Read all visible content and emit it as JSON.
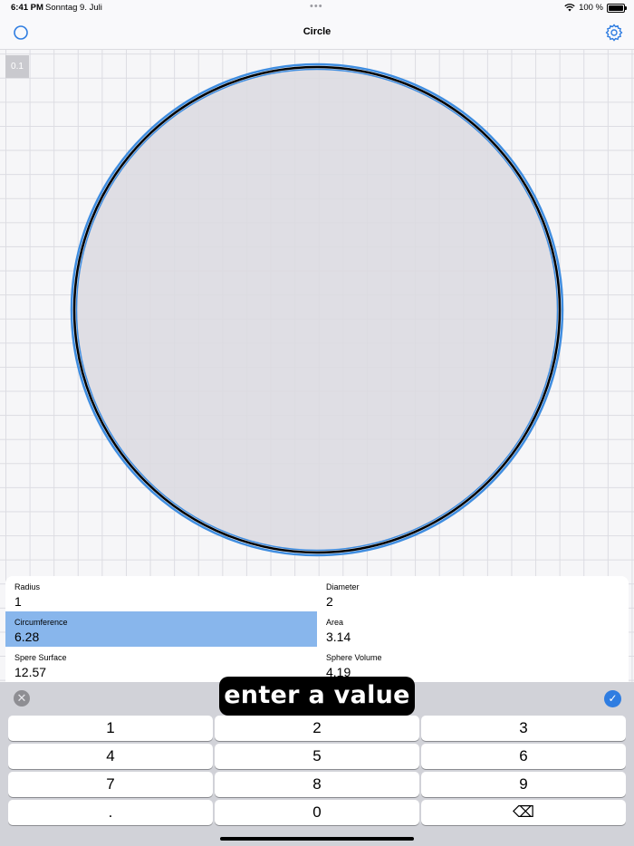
{
  "status": {
    "time": "6:41 PM",
    "date": "Sonntag 9. Juli",
    "dots": "•••",
    "battery": "100 %"
  },
  "nav": {
    "title": "Circle",
    "left_icon": "circle-icon",
    "right_icon": "settings-gear-icon"
  },
  "scale_badge": "0.1",
  "shape": {
    "fill": "#dcdbe0",
    "stroke": "#000000",
    "highlight": "#3f8de0"
  },
  "fields": [
    {
      "label": "Radius",
      "value": "1",
      "selected": false
    },
    {
      "label": "Diameter",
      "value": "2",
      "selected": false
    },
    {
      "label": "Circumference",
      "value": "6.28",
      "selected": true
    },
    {
      "label": "Area",
      "value": "3.14",
      "selected": false
    },
    {
      "label": "Spere Surface",
      "value": "12.57",
      "selected": false
    },
    {
      "label": "Sphere Volume",
      "value": "4.19",
      "selected": false
    }
  ],
  "keyboard": {
    "cancel_icon": "✕",
    "done_icon": "✓",
    "hint": "enter a value",
    "keys": [
      "1",
      "2",
      "3",
      "4",
      "5",
      "6",
      "7",
      "8",
      "9",
      ".",
      "0",
      "⌫"
    ]
  },
  "colors": {
    "accent": "#2f7de1",
    "selection": "#88b6ec"
  }
}
